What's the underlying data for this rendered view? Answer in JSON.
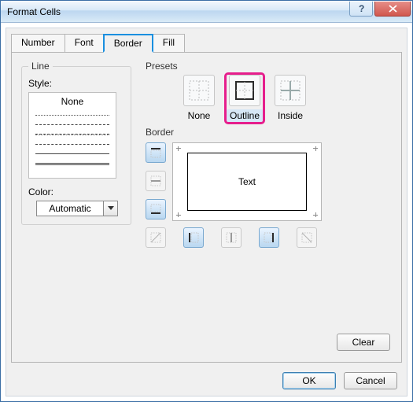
{
  "window": {
    "title": "Format Cells"
  },
  "tabs": {
    "number": "Number",
    "font": "Font",
    "border": "Border",
    "fill": "Fill",
    "active": "border"
  },
  "line": {
    "group": "Line",
    "style_label": "Style:",
    "none_label": "None",
    "color_label": "Color:",
    "color_value": "Automatic"
  },
  "presets": {
    "group": "Presets",
    "none": "None",
    "outline": "Outline",
    "inside": "Inside",
    "selected": "outline"
  },
  "border": {
    "group": "Border",
    "preview_text": "Text"
  },
  "buttons": {
    "clear": "Clear",
    "ok": "OK",
    "cancel": "Cancel"
  }
}
